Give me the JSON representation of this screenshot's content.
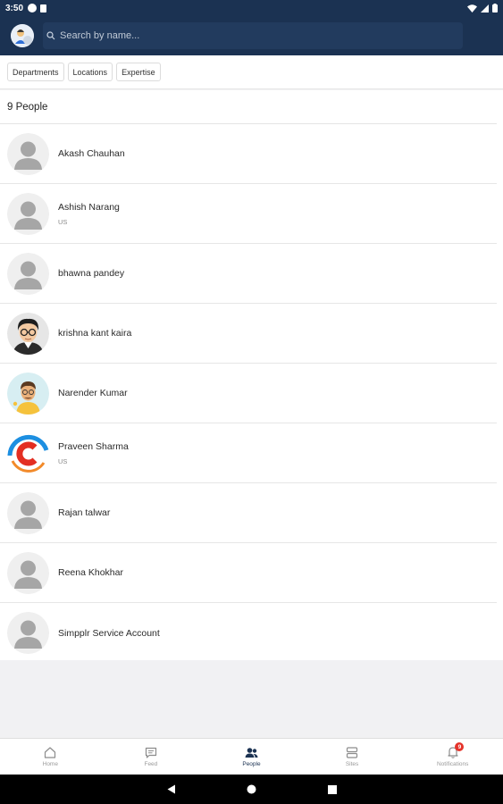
{
  "status_bar": {
    "time": "3:50"
  },
  "search": {
    "placeholder": "Search by name..."
  },
  "filters": [
    "Departments",
    "Locations",
    "Expertise"
  ],
  "people_count": "9 People",
  "people": [
    {
      "name": "Akash Chauhan",
      "location": "",
      "avatar": "default-avatar"
    },
    {
      "name": "Ashish Narang",
      "location": "US",
      "avatar": "default-avatar"
    },
    {
      "name": "bhawna pandey",
      "location": "",
      "avatar": "default-avatar"
    },
    {
      "name": "krishna kant kaira",
      "location": "",
      "avatar": "glasses-man-avatar"
    },
    {
      "name": "Narender Kumar",
      "location": "",
      "avatar": "cartoon-man-avatar"
    },
    {
      "name": "Praveen Sharma",
      "location": "US",
      "avatar": "c-logo-avatar"
    },
    {
      "name": "Rajan talwar",
      "location": "",
      "avatar": "default-avatar"
    },
    {
      "name": "Reena Khokhar",
      "location": "",
      "avatar": "default-avatar"
    },
    {
      "name": "Simpplr Service Account",
      "location": "",
      "avatar": "default-avatar"
    }
  ],
  "bottom_nav": [
    {
      "label": "Home",
      "icon": "home-icon",
      "active": false
    },
    {
      "label": "Feed",
      "icon": "feed-icon",
      "active": false
    },
    {
      "label": "People",
      "icon": "people-icon",
      "active": true
    },
    {
      "label": "Sites",
      "icon": "sites-icon",
      "active": false
    },
    {
      "label": "Notifications",
      "icon": "bell-icon",
      "active": false,
      "badge": "9"
    }
  ],
  "colors": {
    "header": "#1b3252",
    "badge": "#e5332a",
    "background": "#f1f1f3"
  }
}
